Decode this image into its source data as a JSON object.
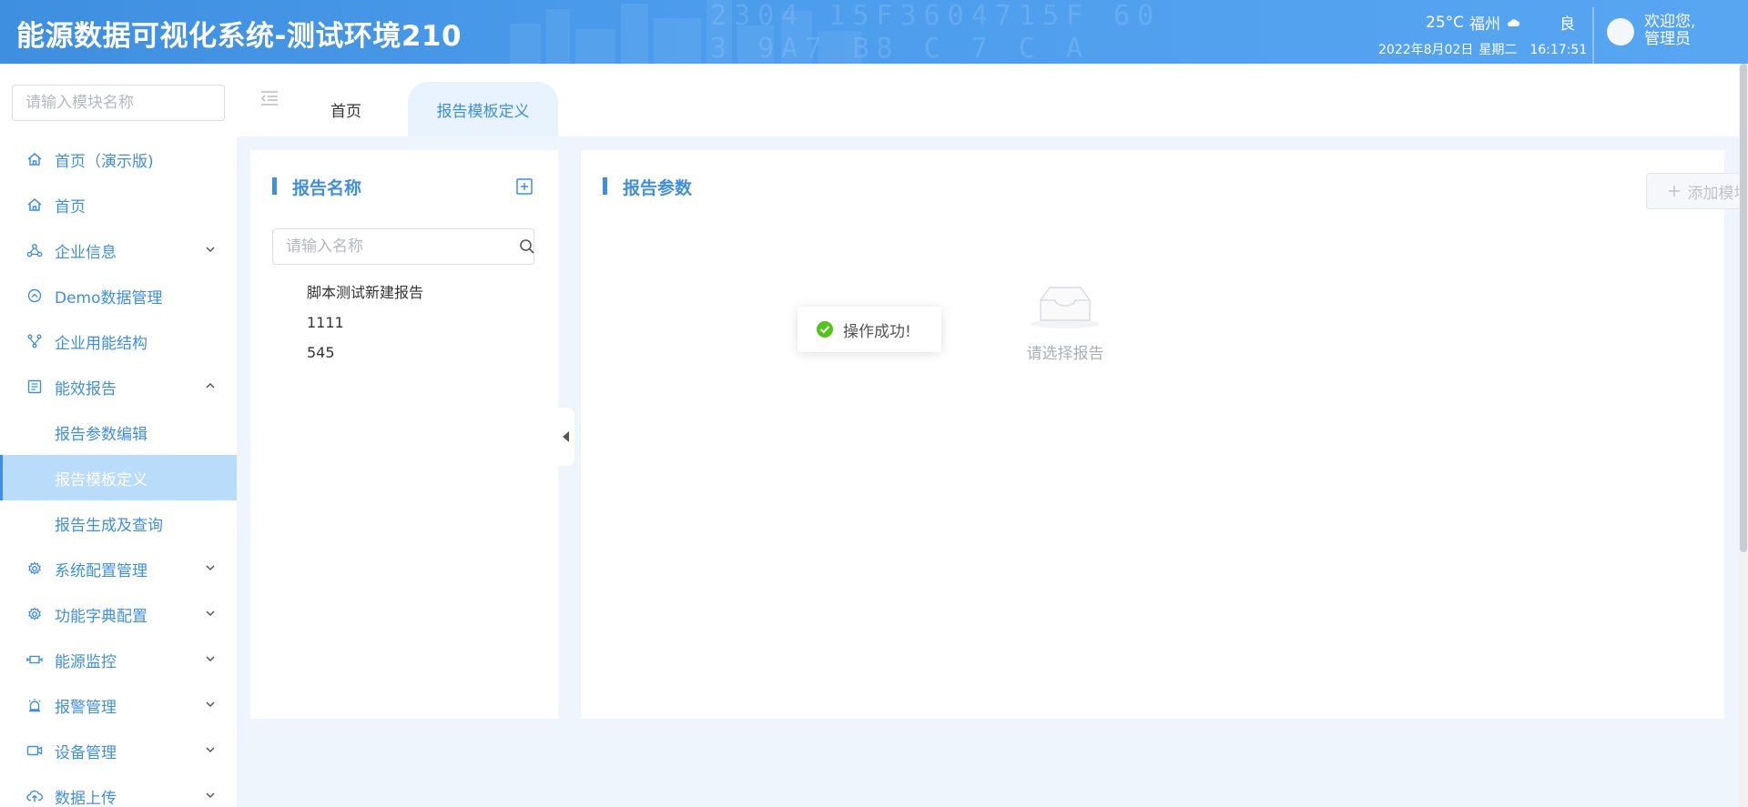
{
  "header": {
    "title": "能源数据可视化系统-测试环境210",
    "temperature": "25°C",
    "city": "福州",
    "weather_icon": "cloud-icon",
    "air_quality": "良",
    "date": "2022年8月02日",
    "weekday": "星期二",
    "time": "16:17:51",
    "welcome_line1": "欢迎您,",
    "welcome_line2": "管理员",
    "bg_text_line1": "2304 15F3604715F 60",
    "bg_text_line2": "3 9A7 B8 C 7 C A"
  },
  "sidebar": {
    "search_placeholder": "请输入模块名称",
    "items": [
      {
        "label": "首页（演示版)",
        "icon": "home-icon"
      },
      {
        "label": "首页",
        "icon": "home-icon"
      },
      {
        "label": "企业信息",
        "icon": "network-icon",
        "expandable": true
      },
      {
        "label": "Demo数据管理",
        "icon": "circle-chevron-icon"
      },
      {
        "label": "企业用能结构",
        "icon": "branch-icon"
      },
      {
        "label": "能效报告",
        "icon": "report-icon",
        "expanded": true
      }
    ],
    "sub_items": [
      {
        "label": "报告参数编辑"
      },
      {
        "label": "报告模板定义",
        "active": true
      },
      {
        "label": "报告生成及查询"
      }
    ],
    "items_after": [
      {
        "label": "系统配置管理",
        "icon": "gear-icon"
      },
      {
        "label": "功能字典配置",
        "icon": "gear-icon"
      },
      {
        "label": "能源监控",
        "icon": "monitor-icon"
      },
      {
        "label": "报警管理",
        "icon": "alarm-icon"
      },
      {
        "label": "设备管理",
        "icon": "camera-icon"
      },
      {
        "label": "数据上传",
        "icon": "upload-icon"
      }
    ]
  },
  "tabs": {
    "home": "首页",
    "active": "报告模板定义"
  },
  "left_panel": {
    "title": "报告名称",
    "search_placeholder": "请输入名称",
    "reports": [
      "脚本测试新建报告",
      "1111",
      "545"
    ]
  },
  "right_panel": {
    "title": "报告参数",
    "add_module_label": "添加模块",
    "empty_text": "请选择报告"
  },
  "toast": {
    "message": "操作成功!"
  },
  "colors": {
    "primary": "#3f8fe0",
    "header_bg": "#4b9cec",
    "active_bg": "#b9dcfb",
    "content_bg": "#eef5fc",
    "success": "#52c41a"
  }
}
